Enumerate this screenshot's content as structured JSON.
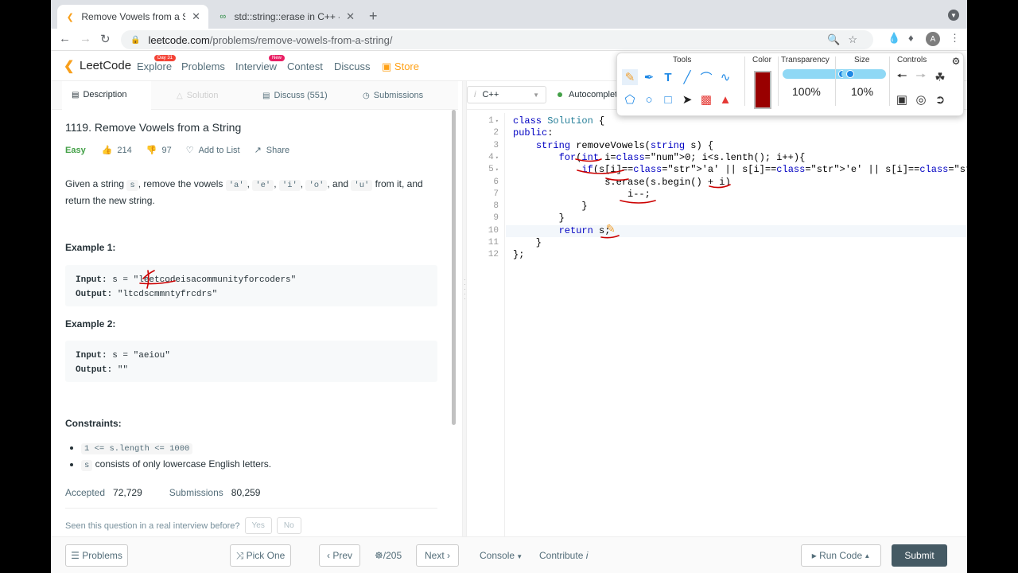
{
  "browser": {
    "tabs": [
      {
        "title": "Remove Vowels from a String - ",
        "active": true
      },
      {
        "title": "std::string::erase in C++ - Geeks",
        "active": false
      }
    ],
    "url_host": "leetcode.com",
    "url_path": "/problems/remove-vowels-from-a-string/",
    "avatar_letter": "A"
  },
  "nav": {
    "logo": "LeetCode",
    "items": [
      "Explore",
      "Problems",
      "Interview",
      "Contest",
      "Discuss",
      "Store"
    ],
    "explore_badge": "Day 31",
    "interview_badge": "New"
  },
  "subtabs": {
    "description": "Description",
    "solution": "Solution",
    "discuss": "Discuss (551)",
    "submissions": "Submissions"
  },
  "problem": {
    "title": "1119. Remove Vowels from a String",
    "difficulty": "Easy",
    "likes": "214",
    "dislikes": "97",
    "add_to_list": "Add to List",
    "share": "Share",
    "desc_1": "Given a string ",
    "desc_s": "s",
    "desc_2": ", remove the vowels ",
    "v_a": "'a'",
    "v_e": "'e'",
    "v_i": "'i'",
    "v_o": "'o'",
    "desc_and": ", and ",
    "v_u": "'u'",
    "desc_3": " from it, and return the new string.",
    "sep": ", ",
    "example1_heading": "Example 1:",
    "example1_input_label": "Input:",
    "example1_input": " s = \"leetcodeisacommunityforcoders\"",
    "example1_output_label": "Output:",
    "example1_output": " \"ltcdscmmntyfrcdrs\"",
    "example2_heading": "Example 2:",
    "example2_input_label": "Input:",
    "example2_input": " s = \"aeiou\"",
    "example2_output_label": "Output:",
    "example2_output": " \"\"",
    "constraints_heading": "Constraints:",
    "constraint_1": "1 <= s.length <= 1000",
    "constraint_2_code": "s",
    "constraint_2": " consists of only lowercase English letters.",
    "accepted_label": "Accepted",
    "accepted": "72,729",
    "submissions_label": "Submissions",
    "submissions": "80,259",
    "seen_question": "Seen this question in a real interview before?",
    "yes": "Yes",
    "no": "No"
  },
  "editor": {
    "language": "C++",
    "autocomplete": "Autocomplet",
    "line_numbers": [
      "1",
      "2",
      "3",
      "4",
      "5",
      "6",
      "7",
      "8",
      "9",
      "10",
      "11",
      "12"
    ],
    "lines": [
      "class Solution {",
      "public:",
      "    string removeVowels(string s) {",
      "        for(int i=0; i<s.lenth(); i++){",
      "            if(s[i]=='a' || s[i]=='e' || s[i]=='i' || s[i]=='o' || s[i]=='u'){",
      "                s.erase(s.begin() + i)",
      "                    i--;",
      "            }",
      "        }",
      "        return s;",
      "    }",
      "};"
    ]
  },
  "annotation_toolbar": {
    "tools_label": "Tools",
    "color_label": "Color",
    "transparency_label": "Transparency",
    "size_label": "Size",
    "controls_label": "Controls",
    "transparency_value": "100%",
    "size_value": "10%",
    "transparency_level": 1.0,
    "size_level": 0.1,
    "pen_color": "#990000"
  },
  "bottom_bar": {
    "problems": "Problems",
    "pick_one": "Pick One",
    "prev": "Prev",
    "page": "/205",
    "next": "Next",
    "console": "Console",
    "contribute": "Contribute",
    "run_code": "Run Code",
    "submit": "Submit"
  }
}
